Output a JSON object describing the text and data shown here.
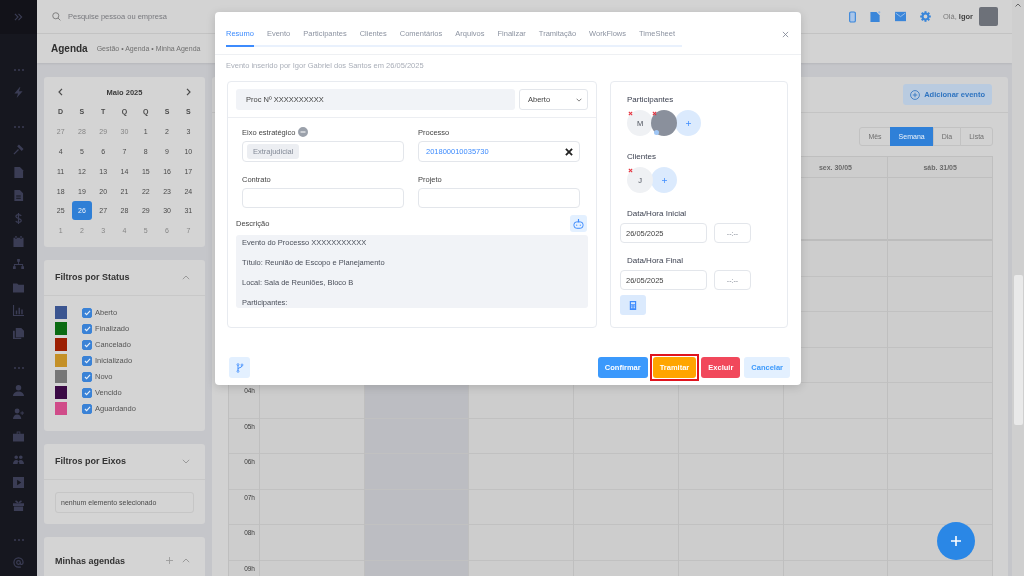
{
  "header": {
    "search": {
      "placeholder": "Pesquise pessoa ou empresa"
    },
    "greeting": "Olá, **Igor**"
  },
  "page_title": "Agenda",
  "breadcrumb": "Gestão • Agenda • Minha Agenda",
  "mini_calendar": {
    "month": "Maio 2025",
    "weekdays": [
      "D",
      "S",
      "T",
      "Q",
      "Q",
      "S",
      "S"
    ],
    "days": [
      {
        "label": "27",
        "outside": true,
        "selected": false
      },
      {
        "label": "28",
        "outside": true,
        "selected": false
      },
      {
        "label": "29",
        "outside": true,
        "selected": false
      },
      {
        "label": "30",
        "outside": true,
        "selected": false
      },
      {
        "label": "1",
        "outside": false,
        "selected": false
      },
      {
        "label": "2",
        "outside": false,
        "selected": false
      },
      {
        "label": "3",
        "outside": false,
        "selected": false
      },
      {
        "label": "4",
        "outside": false,
        "selected": false
      },
      {
        "label": "5",
        "outside": false,
        "selected": false
      },
      {
        "label": "6",
        "outside": false,
        "selected": false
      },
      {
        "label": "7",
        "outside": false,
        "selected": false
      },
      {
        "label": "8",
        "outside": false,
        "selected": false
      },
      {
        "label": "9",
        "outside": false,
        "selected": false
      },
      {
        "label": "10",
        "outside": false,
        "selected": false
      },
      {
        "label": "11",
        "outside": false,
        "selected": false
      },
      {
        "label": "12",
        "outside": false,
        "selected": false
      },
      {
        "label": "13",
        "outside": false,
        "selected": false
      },
      {
        "label": "14",
        "outside": false,
        "selected": false
      },
      {
        "label": "15",
        "outside": false,
        "selected": false
      },
      {
        "label": "16",
        "outside": false,
        "selected": false
      },
      {
        "label": "17",
        "outside": false,
        "selected": false
      },
      {
        "label": "18",
        "outside": false,
        "selected": false
      },
      {
        "label": "19",
        "outside": false,
        "selected": false
      },
      {
        "label": "20",
        "outside": false,
        "selected": false
      },
      {
        "label": "21",
        "outside": false,
        "selected": false
      },
      {
        "label": "22",
        "outside": false,
        "selected": false
      },
      {
        "label": "23",
        "outside": false,
        "selected": false
      },
      {
        "label": "24",
        "outside": false,
        "selected": false
      },
      {
        "label": "25",
        "outside": false,
        "selected": false
      },
      {
        "label": "26",
        "outside": false,
        "selected": true
      },
      {
        "label": "27",
        "outside": false,
        "selected": false
      },
      {
        "label": "28",
        "outside": false,
        "selected": false
      },
      {
        "label": "29",
        "outside": false,
        "selected": false
      },
      {
        "label": "30",
        "outside": false,
        "selected": false
      },
      {
        "label": "31",
        "outside": false,
        "selected": false
      },
      {
        "label": "1",
        "outside": true,
        "selected": false
      },
      {
        "label": "2",
        "outside": true,
        "selected": false
      },
      {
        "label": "3",
        "outside": true,
        "selected": false
      },
      {
        "label": "4",
        "outside": true,
        "selected": false
      },
      {
        "label": "5",
        "outside": true,
        "selected": false
      },
      {
        "label": "6",
        "outside": true,
        "selected": false
      },
      {
        "label": "7",
        "outside": true,
        "selected": false
      }
    ]
  },
  "status_filters": {
    "title": "Filtros por Status",
    "expanded": true,
    "items": [
      {
        "label": "Aberto",
        "color": "#3b5590",
        "checked": true
      },
      {
        "label": "Finalizado",
        "color": "#0b6a12",
        "checked": true
      },
      {
        "label": "Cancelado",
        "color": "#9c1f02",
        "checked": true
      },
      {
        "label": "Inicializado",
        "color": "#c49027",
        "checked": true
      },
      {
        "label": "Novo",
        "color": "#777777",
        "checked": true
      },
      {
        "label": "Vencido",
        "color": "#3b0a45",
        "checked": true
      },
      {
        "label": "Aguardando",
        "color": "#d04c89",
        "checked": true
      }
    ]
  },
  "axis_filters": {
    "title": "Filtros por Eixos",
    "expanded": false,
    "select": {
      "value": "nenhum elemento selecionado"
    }
  },
  "my_agendas": {
    "title": "Minhas agendas",
    "expanded": true
  },
  "main": {
    "add_event": "Adicionar evento",
    "views": [
      {
        "label": "Mês",
        "selected": false
      },
      {
        "label": "Semana",
        "selected": true
      },
      {
        "label": "Dia",
        "selected": false
      },
      {
        "label": "Lista",
        "selected": false
      }
    ],
    "week": {
      "columns": [
        {
          "today": false
        },
        {
          "today": true
        },
        {
          "today": false
        },
        {
          "today": false
        },
        {
          "today": false
        },
        {
          "header": "sex. 30/05",
          "today": false
        },
        {
          "header": "sáb. 31/05",
          "today": false
        }
      ],
      "hours": [
        "04h",
        "05h",
        "06h",
        "07h",
        "08h",
        "09h"
      ]
    }
  },
  "modal": {
    "tabs": [
      {
        "label": "Resumo",
        "selected": true
      },
      {
        "label": "Evento",
        "selected": false
      },
      {
        "label": "Participantes",
        "selected": false
      },
      {
        "label": "Clientes",
        "selected": false
      },
      {
        "label": "Comentários",
        "selected": false
      },
      {
        "label": "Arquivos",
        "selected": false
      },
      {
        "label": "Finalizar",
        "selected": false
      },
      {
        "label": "Tramitação",
        "selected": false
      },
      {
        "label": "WorkFlows",
        "selected": false
      },
      {
        "label": "TimeSheet",
        "selected": false
      }
    ],
    "created_note": "Evento inserido por Igor Gabriel dos Santos em 26/05/2025",
    "proc_field": {
      "value": "Proc Nº XXXXXXXXXX"
    },
    "status_select": {
      "value": "Aberto"
    },
    "fields": [
      {
        "kind": "chips",
        "label": "Eixo estratégico",
        "chips": [
          "Extrajudicial"
        ]
      },
      {
        "kind": "link",
        "label": "Processo",
        "value": "201800010035730"
      },
      {
        "kind": "text",
        "label": "Contrato"
      },
      {
        "kind": "text",
        "label": "Projeto"
      }
    ],
    "description": {
      "label": "Descrição",
      "lines": [
        "Evento do Processo XXXXXXXXXXX",
        "Título: Reunião de Escopo e Planejamento",
        "Local: Sala de Reuniões, Bloco B",
        "Participantes:"
      ]
    },
    "participants": {
      "label": "Participantes",
      "people": [
        {
          "kind": "initial",
          "initial": "M"
        },
        {
          "kind": "photo"
        }
      ]
    },
    "clients": {
      "label": "Clientes",
      "people": [
        {
          "kind": "initial",
          "initial": "J"
        }
      ]
    },
    "start": {
      "label": "Data/Hora Inicial",
      "date": "26/05/2025",
      "time": {
        "placeholder": "--:--"
      }
    },
    "end": {
      "label": "Data/Hora Final",
      "date": "26/05/2025",
      "time": {
        "placeholder": "--:--"
      }
    },
    "buttons": [
      {
        "label": "Confirmar",
        "kind": "primary",
        "highlighted": false
      },
      {
        "label": "Tramitar",
        "kind": "warning",
        "highlighted": true
      },
      {
        "label": "Excluir",
        "kind": "danger",
        "highlighted": false
      },
      {
        "label": "Cancelar",
        "kind": "light",
        "highlighted": false
      }
    ]
  }
}
